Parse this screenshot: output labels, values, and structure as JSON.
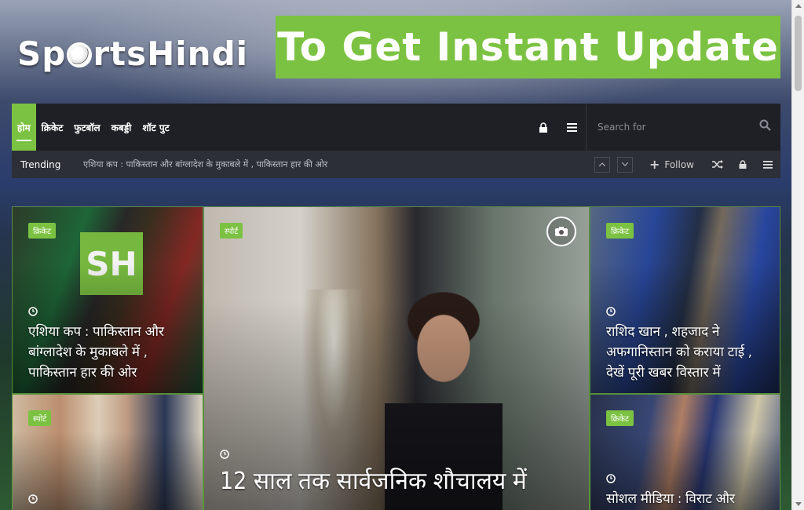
{
  "site": {
    "logo_text": "SportsHindi",
    "banner_text": "To Get Instant Update"
  },
  "nav": {
    "items": [
      {
        "label": "होम",
        "active": true
      },
      {
        "label": "क्रिकेट",
        "active": false
      },
      {
        "label": "फुटबॉल",
        "active": false
      },
      {
        "label": "कबड्डी",
        "active": false
      },
      {
        "label": "शॉट पुट",
        "active": false
      }
    ],
    "search_placeholder": "Search for"
  },
  "trending": {
    "label": "Trending",
    "headline": "एशिया कप : पाकिस्तान और बांग्लादेश के मुकाबले में , पाकिस्तान हार की ओर",
    "follow_label": "Follow"
  },
  "cards": [
    {
      "category": "क्रिकेट",
      "title": "एशिया कप : पाकिस्तान और बांग्लादेश के मुकाबले में , पाकिस्तान हार की ओर"
    },
    {
      "category": "स्पोर्ट",
      "title": "12 साल तक सार्वजनिक शौचालय में"
    },
    {
      "category": "क्रिकेट",
      "title": "राशिद खान , शहजाद ने अफगानिस्तान को कराया टाई , देखें पूरी खबर विस्तार में"
    },
    {
      "category": "स्पोर्ट",
      "title": ""
    },
    {
      "category": "क्रिकेट",
      "title": "सोशल मीडिया : विराट और"
    }
  ],
  "colors": {
    "accent": "#7cc242",
    "nav_bg": "#1e2026",
    "trending_bg": "#2c2f36"
  }
}
